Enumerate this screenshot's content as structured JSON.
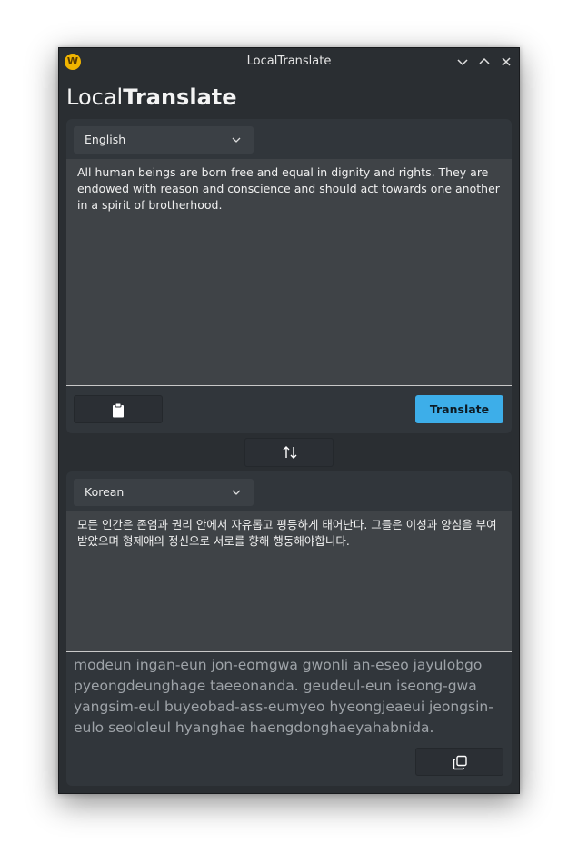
{
  "window": {
    "title": "LocalTranslate",
    "icon": "app-logo-icon"
  },
  "heading": {
    "light": "Local",
    "bold": "Translate"
  },
  "source": {
    "language": "English",
    "text": "All human beings are born free and equal in dignity and rights. They are endowed with reason and conscience and should act towards one another in a spirit of brotherhood.",
    "paste_icon": "clipboard-icon",
    "translate_label": "Translate"
  },
  "swap": {
    "icon": "swap-vertical-icon"
  },
  "target": {
    "language": "Korean",
    "text": "모든 인간은 존엄과 권리 안에서 자유롭고 평등하게 태어난다. 그들은 이성과 양심을 부여받았으며 형제애의 정신으로 서로를 향해 행동해야합니다.",
    "romanization": "modeun ingan-eun jon-eomgwa gwonli an-eseo jayulobgo pyeongdeunghage taeeonanda. geudeul-eun iseong-gwa yangsim-eul buyeobad-ass-eumyeo hyeongjeaeui jeongsin-eulo seololeul hyanghae haengdonghaeyahabnida.",
    "copy_icon": "copy-icon"
  },
  "colors": {
    "accent": "#3daee9",
    "window_bg": "#2a2e32",
    "panel_bg": "#31363b",
    "text_area_bg": "#3f4347"
  }
}
